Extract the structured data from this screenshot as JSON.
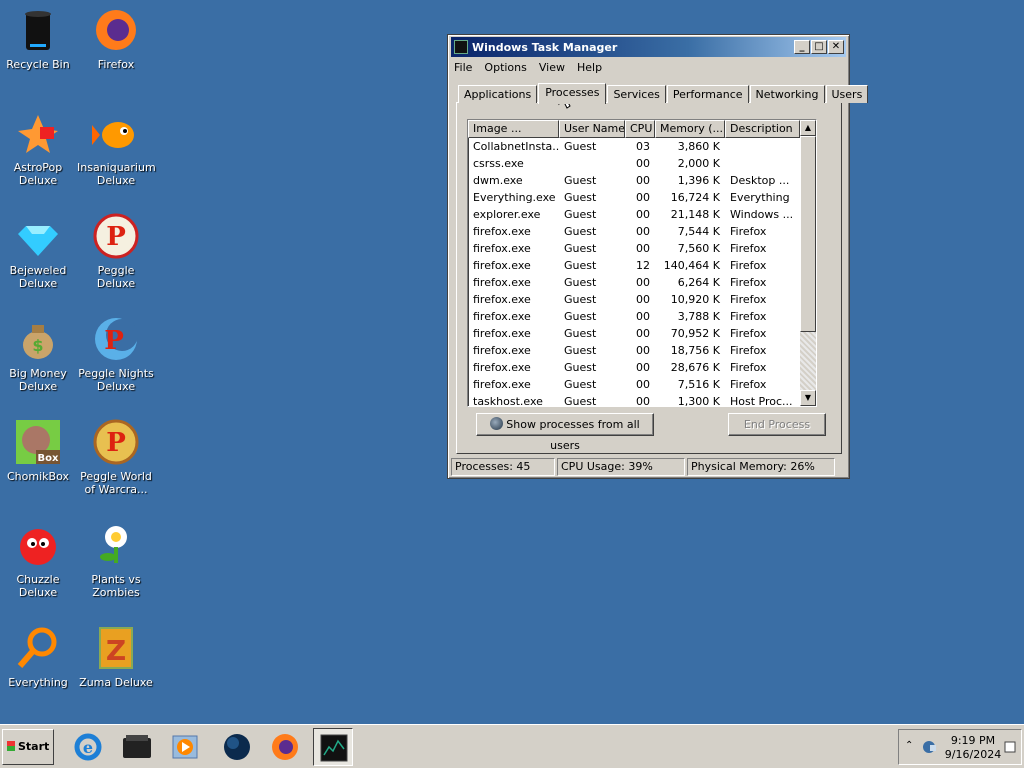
{
  "desktop": {
    "icons": [
      {
        "label": "Recycle Bin",
        "icon": "recycle-bin-icon"
      },
      {
        "label": "Firefox",
        "icon": "firefox-icon"
      },
      {
        "label": "AstroPop Deluxe",
        "icon": "astropop-icon"
      },
      {
        "label": "Insaniquarium Deluxe",
        "icon": "insaniquarium-icon"
      },
      {
        "label": "Bejeweled Deluxe",
        "icon": "bejeweled-icon"
      },
      {
        "label": "Peggle Deluxe",
        "icon": "peggle-icon"
      },
      {
        "label": "Big Money Deluxe",
        "icon": "big-money-icon"
      },
      {
        "label": "Peggle Nights Deluxe",
        "icon": "peggle-nights-icon"
      },
      {
        "label": "ChomikBox",
        "icon": "chomikbox-icon"
      },
      {
        "label": "Peggle World of Warcra...",
        "icon": "peggle-wow-icon"
      },
      {
        "label": "Chuzzle Deluxe",
        "icon": "chuzzle-icon"
      },
      {
        "label": "Plants vs Zombies",
        "icon": "plants-vs-zombies-icon"
      },
      {
        "label": "Everything",
        "icon": "everything-icon"
      },
      {
        "label": "Zuma Deluxe",
        "icon": "zuma-icon"
      }
    ]
  },
  "window": {
    "title": "Windows Task Manager",
    "controls": {
      "minimize": "_",
      "maximize": "□",
      "close": "✕"
    },
    "menu": [
      "File",
      "Options",
      "View",
      "Help"
    ],
    "tabs": [
      "Applications",
      "Processes",
      "Services",
      "Performance",
      "Networking",
      "Users"
    ],
    "active_tab": "Processes",
    "columns": [
      "Image ...",
      "User Name",
      "CPU",
      "Memory (...",
      "Description"
    ],
    "rows": [
      [
        "CollabnetInsta...",
        "Guest",
        "03",
        "3,860 K",
        ""
      ],
      [
        "csrss.exe",
        "",
        "00",
        "2,000 K",
        ""
      ],
      [
        "dwm.exe",
        "Guest",
        "00",
        "1,396 K",
        "Desktop ..."
      ],
      [
        "Everything.exe",
        "Guest",
        "00",
        "16,724 K",
        "Everything"
      ],
      [
        "explorer.exe",
        "Guest",
        "00",
        "21,148 K",
        "Windows ..."
      ],
      [
        "firefox.exe",
        "Guest",
        "00",
        "7,544 K",
        "Firefox"
      ],
      [
        "firefox.exe",
        "Guest",
        "00",
        "7,560 K",
        "Firefox"
      ],
      [
        "firefox.exe",
        "Guest",
        "12",
        "140,464 K",
        "Firefox"
      ],
      [
        "firefox.exe",
        "Guest",
        "00",
        "6,264 K",
        "Firefox"
      ],
      [
        "firefox.exe",
        "Guest",
        "00",
        "10,920 K",
        "Firefox"
      ],
      [
        "firefox.exe",
        "Guest",
        "00",
        "3,788 K",
        "Firefox"
      ],
      [
        "firefox.exe",
        "Guest",
        "00",
        "70,952 K",
        "Firefox"
      ],
      [
        "firefox.exe",
        "Guest",
        "00",
        "18,756 K",
        "Firefox"
      ],
      [
        "firefox.exe",
        "Guest",
        "00",
        "28,676 K",
        "Firefox"
      ],
      [
        "firefox.exe",
        "Guest",
        "00",
        "7,516 K",
        "Firefox"
      ],
      [
        "taskhost.exe",
        "Guest",
        "00",
        "1,300 K",
        "Host Proc..."
      ]
    ],
    "show_all_label": "Show processes from all users",
    "end_process_label": "End Process",
    "status": {
      "processes": "Processes: 45",
      "cpu": "CPU Usage: 39%",
      "memory": "Physical Memory: 26%"
    }
  },
  "taskbar": {
    "start_label": "Start",
    "items": [
      "internet-explorer-icon",
      "folder-icon",
      "media-player-icon",
      "globe-icon",
      "firefox-icon",
      "task-manager-icon"
    ],
    "active_item": "task-manager-icon",
    "clock_time": "9:19 PM",
    "clock_date": "9/16/2024"
  },
  "colors": {
    "desktop": "#3a6ea5",
    "chrome": "#d4d0c8",
    "titlebar": "#0a246a"
  }
}
